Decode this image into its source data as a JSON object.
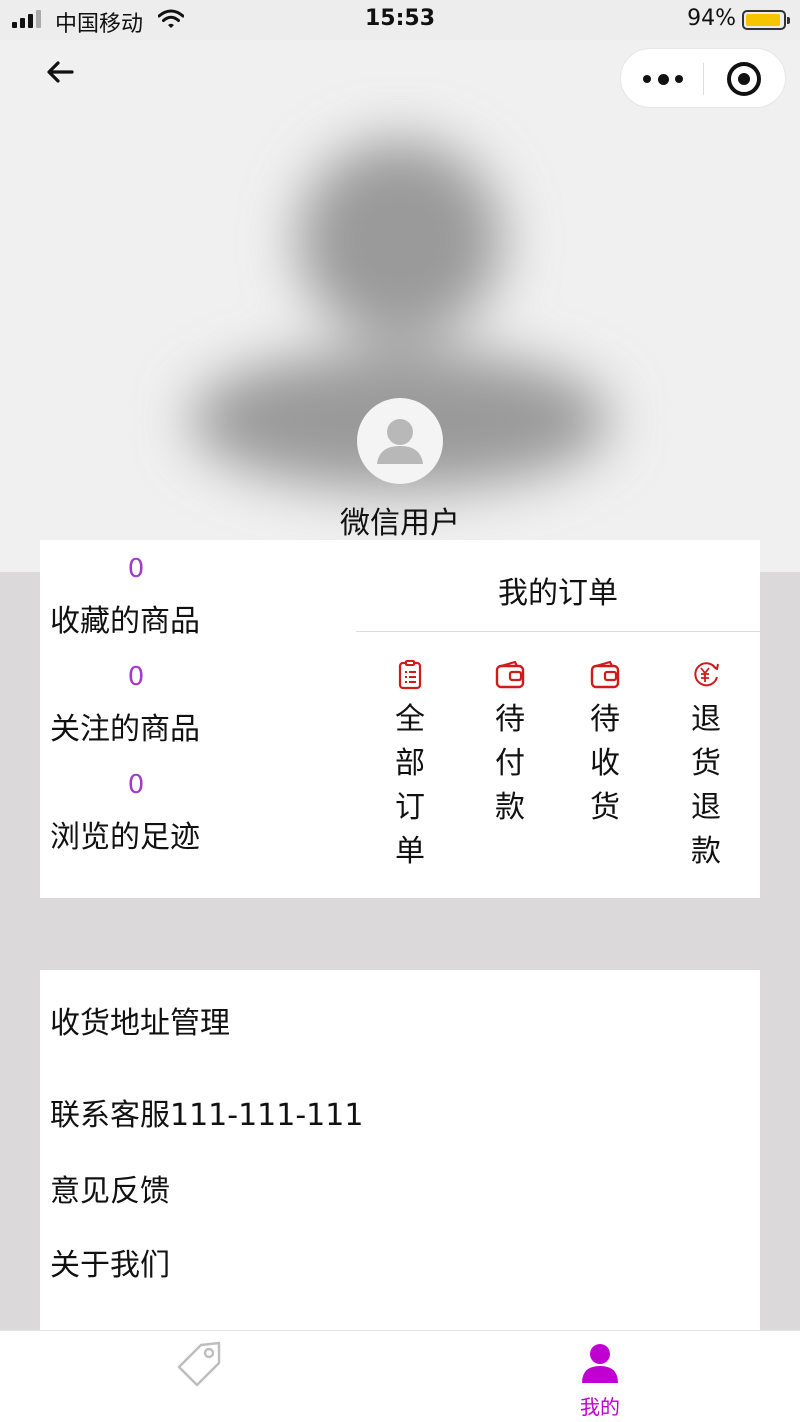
{
  "status_bar": {
    "carrier": "中国移动",
    "time": "15:53",
    "battery": "94%",
    "battery_level": 0.94
  },
  "header": {
    "nickname": "微信用户"
  },
  "stats": [
    {
      "count": "0",
      "label": "收藏的商品"
    },
    {
      "count": "0",
      "label": "关注的商品"
    },
    {
      "count": "0",
      "label": "浏览的足迹"
    }
  ],
  "orders": {
    "title": "我的订单",
    "items": [
      {
        "label": "全部订单",
        "icon": "clipboard-icon"
      },
      {
        "label": "待付款",
        "icon": "wallet-icon"
      },
      {
        "label": "待收货",
        "icon": "wallet-icon"
      },
      {
        "label": "退货退款",
        "icon": "yuan-refund-icon"
      }
    ]
  },
  "menu": [
    {
      "label": "收货地址管理"
    },
    {
      "label": "联系客服111-111-111"
    },
    {
      "label": "意见反馈"
    },
    {
      "label": "关于我们"
    }
  ],
  "tabbar": {
    "items": [
      {
        "label": "",
        "icon": "tag-icon",
        "active": false
      },
      {
        "label": "我的",
        "icon": "user-icon",
        "active": true
      }
    ]
  },
  "colors": {
    "accent": "#c000d0",
    "count": "#a13bc8",
    "order_icon": "#d11a1a",
    "page_bg": "#dcd9db"
  }
}
